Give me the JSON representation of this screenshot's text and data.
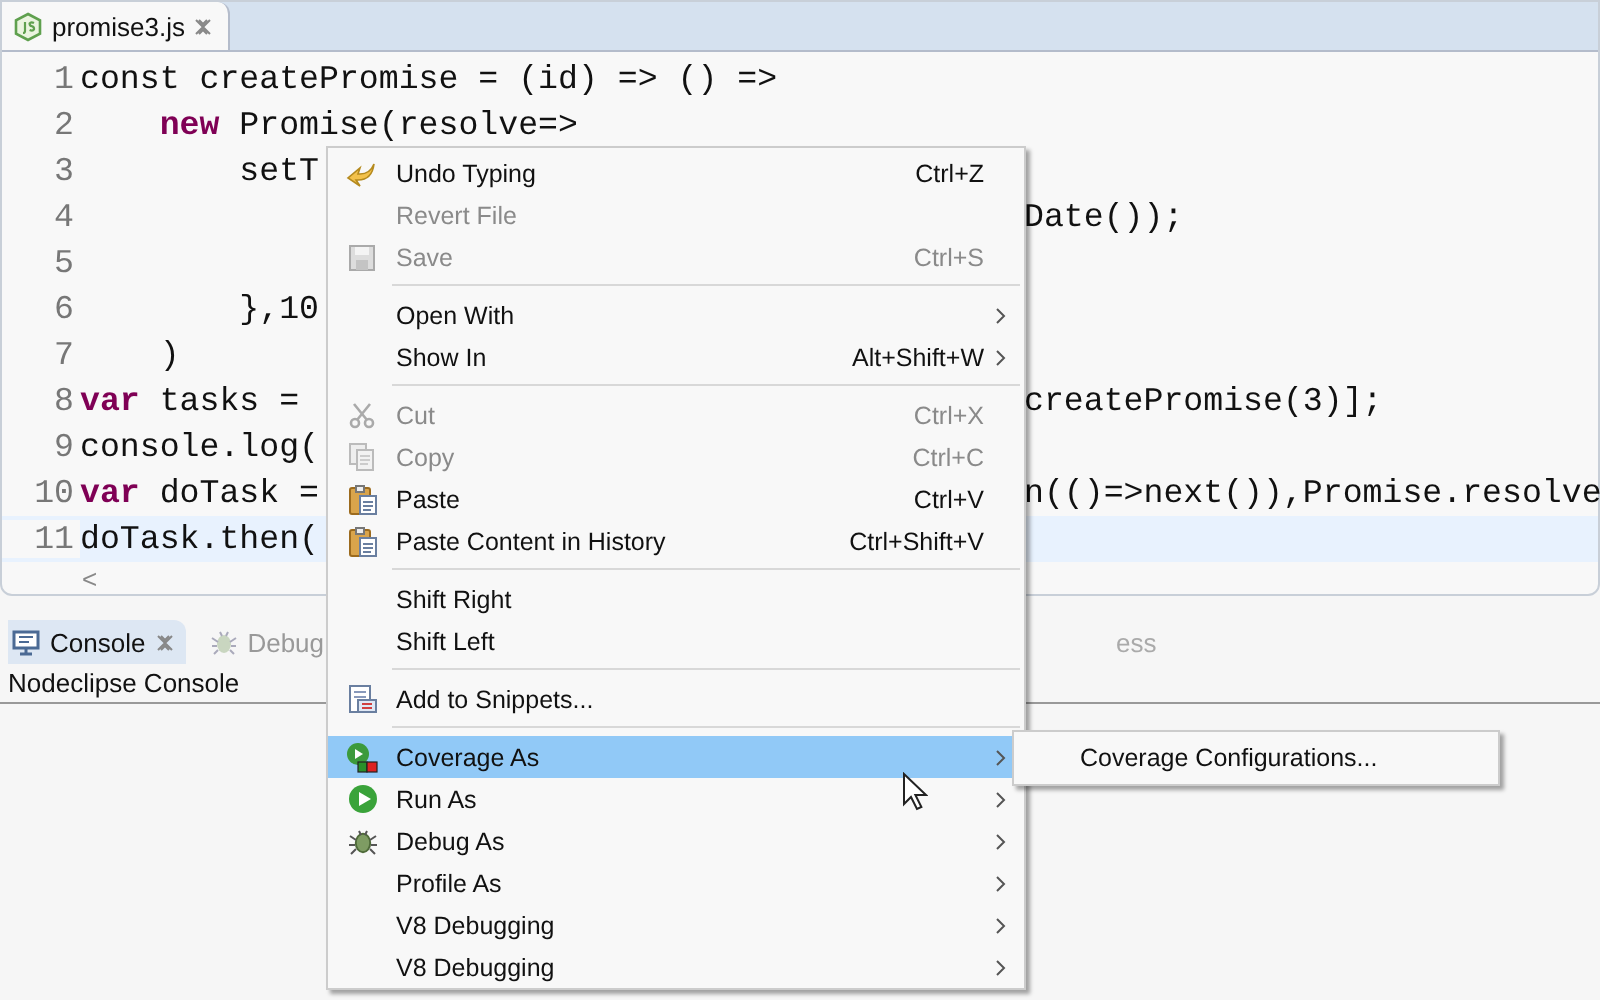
{
  "editor_tab": {
    "title": "promise3.js",
    "selected": true
  },
  "code_lines": [
    {
      "number": "1",
      "left": [
        {
          "text": "const createPromise = (id) => () =>",
          "kind": "plain"
        }
      ],
      "current": false
    },
    {
      "number": "2",
      "left": [
        {
          "text": "    new",
          "kind": "keyword"
        },
        {
          "text": " Promise(resolve=>",
          "kind": "plain"
        }
      ],
      "current": false
    },
    {
      "number": "3",
      "left": [
        {
          "text": "        setT",
          "kind": "plain"
        }
      ],
      "current": false
    },
    {
      "number": "4",
      "right": "Date());",
      "current": false
    },
    {
      "number": "5",
      "current": false
    },
    {
      "number": "6",
      "left": [
        {
          "text": "        },10",
          "kind": "plain"
        }
      ],
      "current": false
    },
    {
      "number": "7",
      "left": [
        {
          "text": "    )",
          "kind": "plain"
        }
      ],
      "current": false
    },
    {
      "number": "8",
      "left": [
        {
          "text": "var",
          "kind": "keyword"
        },
        {
          "text": " tasks =",
          "kind": "plain"
        }
      ],
      "right": "createPromise(3)];",
      "current": false
    },
    {
      "number": "9",
      "left": [
        {
          "text": "console.log(",
          "kind": "plain"
        }
      ],
      "current": false
    },
    {
      "number": "10",
      "left": [
        {
          "text": "var",
          "kind": "keyword"
        },
        {
          "text": " doTask =",
          "kind": "plain"
        }
      ],
      "right": "n(()=>next()),Promise.resolve",
      "current": false
    },
    {
      "number": "11",
      "left": [
        {
          "text": "doTask.then(",
          "kind": "plain"
        }
      ],
      "current": true
    }
  ],
  "scroll_left": "<",
  "panel_tabs": [
    {
      "label": "Console",
      "selected": true,
      "closable": true
    },
    {
      "label": "Debug",
      "selected": false,
      "closable": false
    }
  ],
  "panel_tab_partial": "ess",
  "console_title": "Nodeclipse Console",
  "context_menu": [
    {
      "kind": "item",
      "label": "Undo Typing",
      "shortcut": "Ctrl+Z",
      "disabled": false,
      "submenu": false,
      "selected": false
    },
    {
      "kind": "item",
      "label": "Revert File",
      "disabled": true,
      "submenu": false,
      "selected": false
    },
    {
      "kind": "item",
      "label": "Save",
      "shortcut": "Ctrl+S",
      "disabled": true,
      "submenu": false,
      "selected": false
    },
    {
      "kind": "separator"
    },
    {
      "kind": "item",
      "label": "Open With",
      "disabled": false,
      "submenu": true,
      "selected": false
    },
    {
      "kind": "item",
      "label": "Show In",
      "shortcut": "Alt+Shift+W",
      "disabled": false,
      "submenu": true,
      "selected": false
    },
    {
      "kind": "separator"
    },
    {
      "kind": "item",
      "label": "Cut",
      "shortcut": "Ctrl+X",
      "disabled": true,
      "submenu": false,
      "selected": false
    },
    {
      "kind": "item",
      "label": "Copy",
      "shortcut": "Ctrl+C",
      "disabled": true,
      "submenu": false,
      "selected": false
    },
    {
      "kind": "item",
      "label": "Paste",
      "shortcut": "Ctrl+V",
      "disabled": false,
      "submenu": false,
      "selected": false
    },
    {
      "kind": "item",
      "label": "Paste Content in History",
      "shortcut": "Ctrl+Shift+V",
      "disabled": false,
      "submenu": false,
      "selected": false
    },
    {
      "kind": "separator"
    },
    {
      "kind": "item",
      "label": "Shift Right",
      "disabled": false,
      "submenu": false,
      "selected": false
    },
    {
      "kind": "item",
      "label": "Shift Left",
      "disabled": false,
      "submenu": false,
      "selected": false
    },
    {
      "kind": "separator"
    },
    {
      "kind": "item",
      "label": "Add to Snippets...",
      "disabled": false,
      "submenu": false,
      "selected": false
    },
    {
      "kind": "separator"
    },
    {
      "kind": "item",
      "label": "Coverage As",
      "disabled": false,
      "submenu": true,
      "selected": true
    },
    {
      "kind": "item",
      "label": "Run As",
      "disabled": false,
      "submenu": true,
      "selected": false
    },
    {
      "kind": "item",
      "label": "Debug As",
      "disabled": false,
      "submenu": true,
      "selected": false
    },
    {
      "kind": "item",
      "label": "Profile As",
      "disabled": false,
      "submenu": true,
      "selected": false
    },
    {
      "kind": "item",
      "label": "V8 Debugging",
      "disabled": false,
      "submenu": true,
      "selected": false
    },
    {
      "kind": "item",
      "label": "V8 Debugging",
      "disabled": false,
      "submenu": true,
      "selected": false
    }
  ],
  "submenu": [
    {
      "label": "Coverage Configurations...",
      "selected": false
    }
  ]
}
